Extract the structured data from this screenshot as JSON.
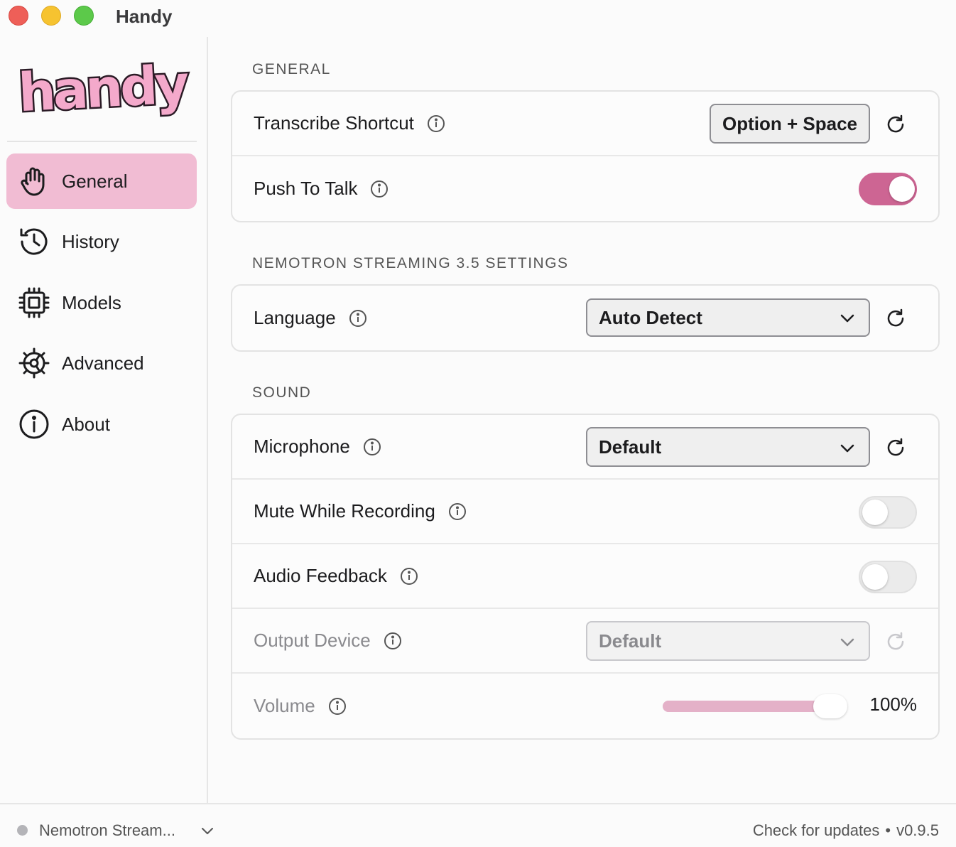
{
  "window": {
    "title": "Handy"
  },
  "logo": {
    "text": "handy",
    "color": "#f4a9cb"
  },
  "sidebar": {
    "items": [
      {
        "label": "General",
        "icon": "hand-icon",
        "active": true
      },
      {
        "label": "History",
        "icon": "history-icon",
        "active": false
      },
      {
        "label": "Models",
        "icon": "chip-icon",
        "active": false
      },
      {
        "label": "Advanced",
        "icon": "gear-icon",
        "active": false
      },
      {
        "label": "About",
        "icon": "info-icon",
        "active": false
      }
    ]
  },
  "sections": {
    "general": {
      "title": "GENERAL",
      "transcribe_shortcut": {
        "label": "Transcribe Shortcut",
        "value": "Option + Space"
      },
      "push_to_talk": {
        "label": "Push To Talk",
        "enabled": true
      }
    },
    "model_settings": {
      "title": "NEMOTRON STREAMING 3.5 SETTINGS",
      "language": {
        "label": "Language",
        "value": "Auto Detect"
      }
    },
    "sound": {
      "title": "SOUND",
      "microphone": {
        "label": "Microphone",
        "value": "Default"
      },
      "mute_while_recording": {
        "label": "Mute While Recording",
        "enabled": false
      },
      "audio_feedback": {
        "label": "Audio Feedback",
        "enabled": false
      },
      "output_device": {
        "label": "Output Device",
        "value": "Default",
        "disabled": true
      },
      "volume": {
        "label": "Volume",
        "value": "100%",
        "level": 1.0,
        "disabled": true
      }
    }
  },
  "footer": {
    "model": "Nemotron Stream...",
    "check_updates": "Check for updates",
    "separator": "•",
    "version": "v0.9.5"
  },
  "colors": {
    "accent": "#cd6593",
    "active_nav": "#f1bcd3",
    "slider_fill": "#e4b1c8"
  }
}
